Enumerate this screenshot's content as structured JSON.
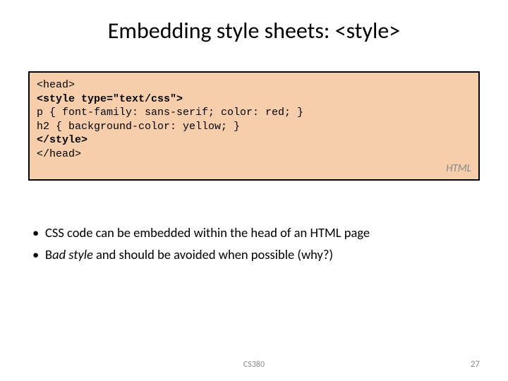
{
  "title": "Embedding style sheets: <style>",
  "code": {
    "line1": "<head>",
    "line2": "<style type=\"text/css\">",
    "line3": "p { font-family: sans-serif; color: red; }",
    "line4": "h2 { background-color: yellow; }",
    "line5": "</style>",
    "line6": "</head>",
    "label": "HTML"
  },
  "bullets": {
    "item1": "CSS code can be embedded within the head of an HTML page",
    "item2_prefix": "B",
    "item2_italic": "ad style",
    "item2_rest": " and should be avoided when possible (why?)"
  },
  "footer": {
    "course": "CS380",
    "page": "27"
  }
}
